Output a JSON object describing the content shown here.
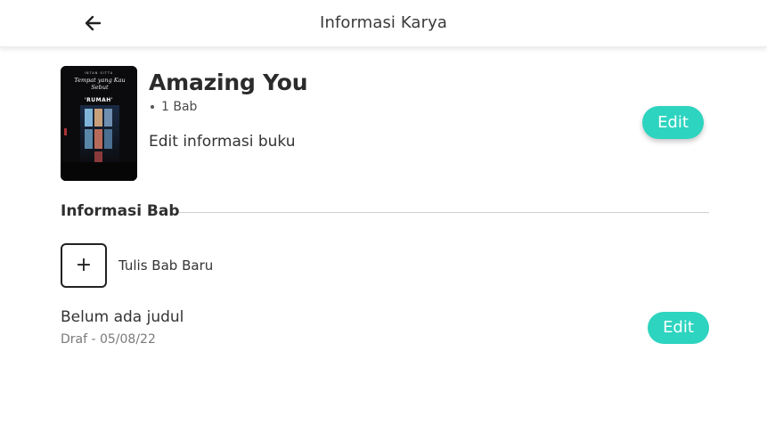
{
  "header": {
    "title": "Informasi Karya",
    "back_icon": "arrow-left-icon"
  },
  "book": {
    "cover": {
      "author": "INTAN SITTA",
      "script_title": "Tempat yang Kau Sebut",
      "bold_title": "'RUMAH'"
    },
    "title": "Amazing You",
    "chapter_count": "1 Bab",
    "edit_info_label": "Edit informasi buku",
    "edit_button_label": "Edit"
  },
  "chapters_section": {
    "heading": "Informasi Bab",
    "add_chapter_label": "Tulis Bab Baru",
    "add_icon": "plus-icon",
    "items": [
      {
        "title": "Belum ada judul",
        "meta": "Draf - 05/08/22",
        "edit_label": "Edit"
      }
    ]
  },
  "colors": {
    "accent": "#2dd4bf",
    "text": "#333333",
    "muted": "#7a7a7a"
  }
}
